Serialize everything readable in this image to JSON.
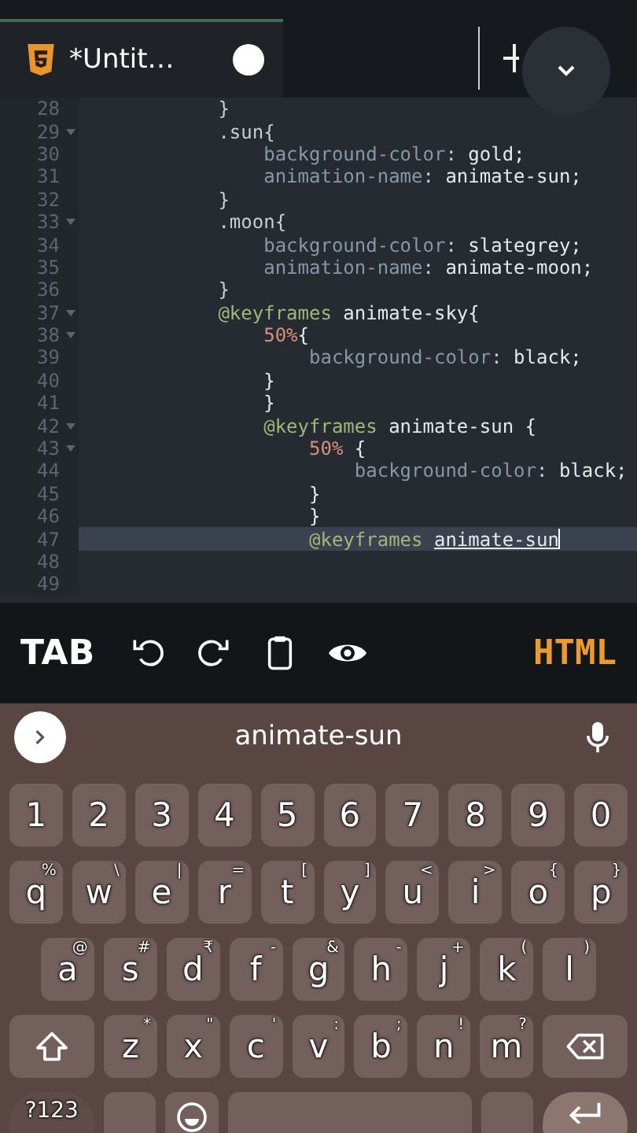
{
  "tabs": [
    {
      "title": "*Untit…",
      "selected": true
    }
  ],
  "editor": {
    "lines": [
      {
        "number": "28",
        "foldable": false,
        "current": false,
        "tokens": [
          {
            "kind": "punct",
            "text": "            }"
          }
        ]
      },
      {
        "number": "29",
        "foldable": true,
        "current": false,
        "tokens": [
          {
            "kind": "selector",
            "text": "            .sun{"
          }
        ]
      },
      {
        "number": "30",
        "foldable": false,
        "current": false,
        "tokens": [
          {
            "kind": "property",
            "text": "                background-color"
          },
          {
            "kind": "punct",
            "text": ": "
          },
          {
            "kind": "value",
            "text": "gold;"
          }
        ]
      },
      {
        "number": "31",
        "foldable": false,
        "current": false,
        "tokens": [
          {
            "kind": "property",
            "text": "                animation-name"
          },
          {
            "kind": "punct",
            "text": ": "
          },
          {
            "kind": "value",
            "text": "animate-sun;"
          }
        ]
      },
      {
        "number": "32",
        "foldable": false,
        "current": false,
        "tokens": [
          {
            "kind": "punct",
            "text": "            }"
          }
        ]
      },
      {
        "number": "33",
        "foldable": true,
        "current": false,
        "tokens": [
          {
            "kind": "selector",
            "text": "            .moon{"
          }
        ]
      },
      {
        "number": "34",
        "foldable": false,
        "current": false,
        "tokens": [
          {
            "kind": "property",
            "text": "                background-color"
          },
          {
            "kind": "punct",
            "text": ": "
          },
          {
            "kind": "value",
            "text": "slategrey;"
          }
        ]
      },
      {
        "number": "35",
        "foldable": false,
        "current": false,
        "tokens": [
          {
            "kind": "property",
            "text": "                animation-name"
          },
          {
            "kind": "punct",
            "text": ": "
          },
          {
            "kind": "value",
            "text": "animate-moon;"
          }
        ]
      },
      {
        "number": "36",
        "foldable": false,
        "current": false,
        "tokens": [
          {
            "kind": "punct",
            "text": "            }"
          }
        ]
      },
      {
        "number": "37",
        "foldable": true,
        "current": false,
        "tokens": [
          {
            "kind": "at",
            "text": "            @keyframes "
          },
          {
            "kind": "value",
            "text": "animate-sky{"
          }
        ]
      },
      {
        "number": "38",
        "foldable": true,
        "current": false,
        "tokens": [
          {
            "kind": "percent",
            "text": "                50%"
          },
          {
            "kind": "value",
            "text": "{"
          }
        ]
      },
      {
        "number": "39",
        "foldable": false,
        "current": false,
        "tokens": [
          {
            "kind": "property",
            "text": "                    background-color"
          },
          {
            "kind": "punct",
            "text": ": "
          },
          {
            "kind": "value",
            "text": "black;"
          }
        ]
      },
      {
        "number": "40",
        "foldable": false,
        "current": false,
        "tokens": [
          {
            "kind": "value",
            "text": "                }"
          }
        ]
      },
      {
        "number": "41",
        "foldable": false,
        "current": false,
        "tokens": [
          {
            "kind": "value",
            "text": "                }"
          }
        ]
      },
      {
        "number": "42",
        "foldable": true,
        "current": false,
        "tokens": [
          {
            "kind": "at",
            "text": "                @keyframes "
          },
          {
            "kind": "value",
            "text": "animate-sun {"
          }
        ]
      },
      {
        "number": "43",
        "foldable": true,
        "current": false,
        "tokens": [
          {
            "kind": "percent",
            "text": "                    50% "
          },
          {
            "kind": "value",
            "text": "{"
          }
        ]
      },
      {
        "number": "44",
        "foldable": false,
        "current": false,
        "tokens": [
          {
            "kind": "property",
            "text": "                        background-color"
          },
          {
            "kind": "punct",
            "text": ": "
          },
          {
            "kind": "value",
            "text": "black;"
          }
        ]
      },
      {
        "number": "45",
        "foldable": false,
        "current": false,
        "tokens": [
          {
            "kind": "value",
            "text": "                    }"
          }
        ]
      },
      {
        "number": "46",
        "foldable": false,
        "current": false,
        "tokens": [
          {
            "kind": "value",
            "text": "                    }"
          }
        ]
      },
      {
        "number": "47",
        "foldable": false,
        "current": true,
        "tokens": [
          {
            "kind": "at",
            "text": "                    @keyframes "
          },
          {
            "kind": "match",
            "text": "animate-sun"
          }
        ]
      },
      {
        "number": "48",
        "foldable": false,
        "current": false
      },
      {
        "number": "49",
        "foldable": false,
        "current": false
      }
    ]
  },
  "toolbar": {
    "items": [
      {
        "kind": "text",
        "label": "TAB"
      },
      {
        "kind": "undo"
      },
      {
        "kind": "redo"
      },
      {
        "kind": "clipboard"
      },
      {
        "kind": "preview"
      }
    ],
    "mode": "HTML"
  },
  "keyboard": {
    "suggestion": "animate-sun",
    "rows": [
      [
        {
          "kind": "char",
          "label": "1"
        },
        {
          "kind": "char",
          "label": "2"
        },
        {
          "kind": "char",
          "label": "3"
        },
        {
          "kind": "char",
          "label": "4"
        },
        {
          "kind": "char",
          "label": "5"
        },
        {
          "kind": "char",
          "label": "6"
        },
        {
          "kind": "char",
          "label": "7"
        },
        {
          "kind": "char",
          "label": "8"
        },
        {
          "kind": "char",
          "label": "9"
        },
        {
          "kind": "char",
          "label": "0"
        }
      ],
      [
        {
          "kind": "char",
          "label": "q",
          "hint": "%"
        },
        {
          "kind": "char",
          "label": "w",
          "hint": "\\"
        },
        {
          "kind": "char",
          "label": "e",
          "hint": "|"
        },
        {
          "kind": "char",
          "label": "r",
          "hint": "="
        },
        {
          "kind": "char",
          "label": "t",
          "hint": "["
        },
        {
          "kind": "char",
          "label": "y",
          "hint": "]"
        },
        {
          "kind": "char",
          "label": "u",
          "hint": "<"
        },
        {
          "kind": "char",
          "label": "i",
          "hint": ">"
        },
        {
          "kind": "char",
          "label": "o",
          "hint": "{"
        },
        {
          "kind": "char",
          "label": "p",
          "hint": "}"
        }
      ],
      [
        {
          "kind": "char",
          "label": "a",
          "hint": "@"
        },
        {
          "kind": "char",
          "label": "s",
          "hint": "#"
        },
        {
          "kind": "char",
          "label": "d",
          "hint": "₹"
        },
        {
          "kind": "char",
          "label": "f",
          "hint": "-"
        },
        {
          "kind": "char",
          "label": "g",
          "hint": "&"
        },
        {
          "kind": "char",
          "label": "h",
          "hint": "-"
        },
        {
          "kind": "char",
          "label": "j",
          "hint": "+"
        },
        {
          "kind": "char",
          "label": "k",
          "hint": "("
        },
        {
          "kind": "char",
          "label": "l",
          "hint": ")"
        }
      ],
      [
        {
          "kind": "shift"
        },
        {
          "kind": "char",
          "label": "z",
          "hint": "*"
        },
        {
          "kind": "char",
          "label": "x",
          "hint": "\""
        },
        {
          "kind": "char",
          "label": "c",
          "hint": "'"
        },
        {
          "kind": "char",
          "label": "v",
          "hint": ":"
        },
        {
          "kind": "char",
          "label": "b",
          "hint": ";"
        },
        {
          "kind": "char",
          "label": "n",
          "hint": "!"
        },
        {
          "kind": "char",
          "label": "m",
          "hint": "?"
        },
        {
          "kind": "backspace"
        }
      ],
      [
        {
          "kind": "symbols",
          "label": "?123"
        },
        {
          "kind": "blank"
        },
        {
          "kind": "emoji"
        },
        {
          "kind": "space"
        },
        {
          "kind": "blank"
        },
        {
          "kind": "enter"
        }
      ]
    ]
  }
}
